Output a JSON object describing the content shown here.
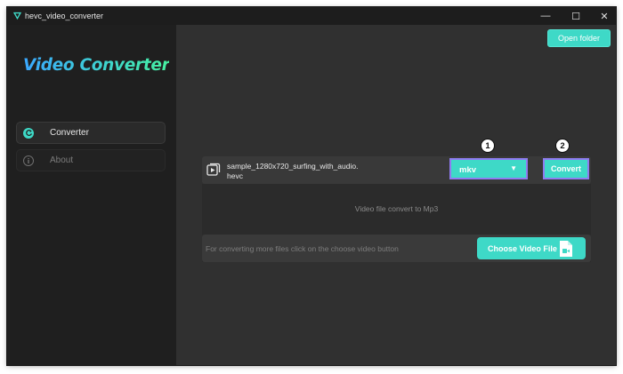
{
  "window": {
    "title": "hevc_video_converter",
    "controls": {
      "minimize": "—",
      "maximize": "☐",
      "close": "✕"
    }
  },
  "sidebar": {
    "logo": "Video Converter",
    "items": [
      {
        "label": "Converter",
        "icon": "refresh-icon",
        "active": true
      },
      {
        "label": "About",
        "icon": "info-icon",
        "active": false
      }
    ]
  },
  "main": {
    "open_folder_label": "Open folder",
    "file": {
      "name_line1": "sample_1280x720_surfing_with_audio.",
      "name_line2": "hevc"
    },
    "format_select": {
      "value": "mkv",
      "caret": "▼"
    },
    "convert_label": "Convert",
    "badges": [
      "1",
      "2"
    ],
    "info_text": "Video file convert to Mp3",
    "hint_text": "For converting more files click on the choose video button",
    "choose_video_label": "Choose Video File"
  },
  "colors": {
    "accent": "#3ed9c7",
    "highlight_border": "#8f7bf0",
    "sidebar_bg": "#1f1f1f",
    "main_bg": "#303030"
  }
}
